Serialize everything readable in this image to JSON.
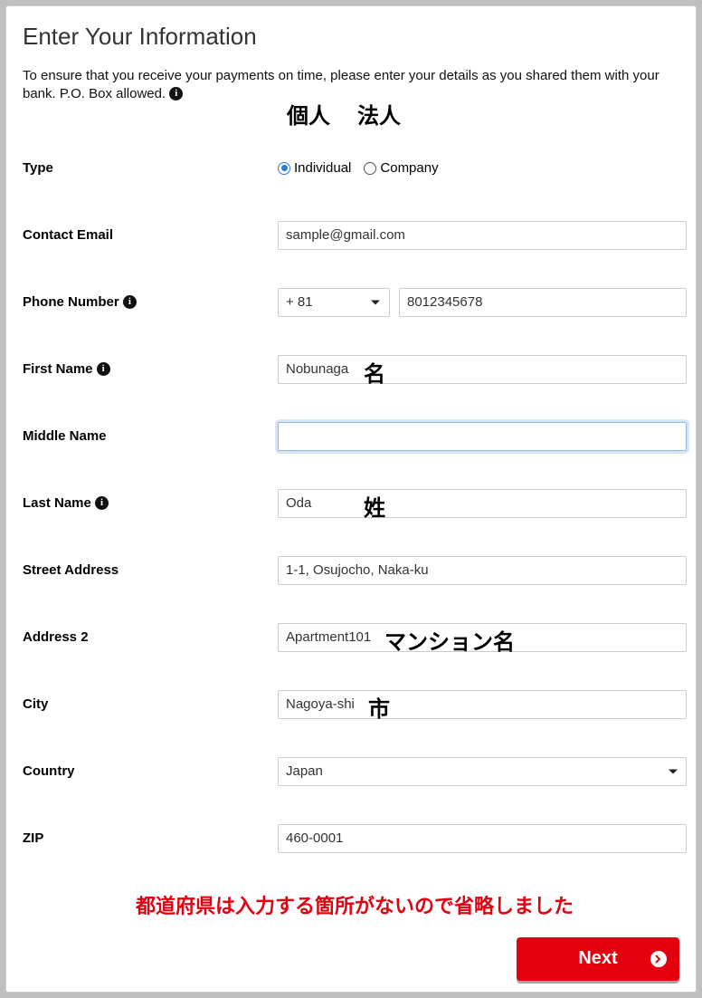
{
  "header": {
    "title": "Enter Your Information",
    "description_prefix": "To ensure that you receive your payments on time, please enter your details as you shared them with your bank. P.O. Box allowed. "
  },
  "annotations": {
    "individual_jp": "個人",
    "company_jp": "法人",
    "first_name_jp": "名",
    "last_name_jp": "姓",
    "apartment_jp": "マンション名",
    "city_jp": "市",
    "prefecture_note": "都道府県は入力する箇所がないので省略しました"
  },
  "labels": {
    "type": "Type",
    "contact_email": "Contact Email",
    "phone_number": "Phone Number",
    "first_name": "First Name",
    "middle_name": "Middle Name",
    "last_name": "Last Name",
    "street_address": "Street Address",
    "address_2": "Address 2",
    "city": "City",
    "country": "Country",
    "zip": "ZIP"
  },
  "type_options": {
    "individual": "Individual",
    "company": "Company",
    "selected": "individual"
  },
  "values": {
    "contact_email": "sample@gmail.com",
    "phone_prefix": "+ 81",
    "phone_number": "8012345678",
    "first_name": "Nobunaga",
    "middle_name": "",
    "last_name": "Oda",
    "street_address": "1-1, Osujocho, Naka-ku",
    "address_2": "Apartment101",
    "city": "Nagoya-shi",
    "country": "Japan",
    "zip": "460-0001"
  },
  "buttons": {
    "next": "Next"
  }
}
